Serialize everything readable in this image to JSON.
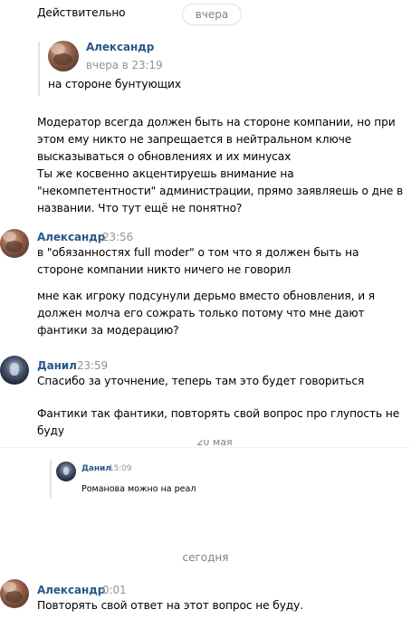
{
  "top_fragment": "Действительно",
  "date_pill": "вчера",
  "reply": {
    "author": "Александр",
    "time": "вчера в 23:19",
    "text": "на стороне бунтующих"
  },
  "message1_lines": [
    "Модератор всегда должен быть на стороне компании, но при",
    "этом ему никто не запрещается в нейтральном ключе",
    "высказываться о обновлениях и их минусах",
    "Ты же косвенно акцентируешь внимание на",
    "\"некомпетентности\" администрации, прямо заявляешь о дне в",
    "названии. Что тут ещё не понятно?"
  ],
  "msg_alex1": {
    "author": "Александр",
    "time": "23:56",
    "lines_a": [
      "в \"обязанностях full moder\" о том что я должен быть на",
      "стороне компании никто ничего не говорил"
    ],
    "lines_b": [
      "мне как игроку подсунули дерьмо вместо обновления, и я",
      "должен молча его сожрать только потому что мне дают",
      "фантики за модерацию?"
    ]
  },
  "msg_danil": {
    "author": "Данил",
    "time": "23:59",
    "line_a": "Спасибо за уточнение, теперь там это будет говориться",
    "lines_b": [
      "Фантики так фантики, повторять свой вопрос про глупость не",
      "буду"
    ]
  },
  "cut_fragment": "20 мая",
  "forward": {
    "author": "Данил",
    "time": "15:09",
    "text": "Романова можно на реал"
  },
  "date_today": "сегодня",
  "msg_alex2": {
    "author": "Александр",
    "time": "0:01",
    "text": "Повторять свой ответ на этот вопрос не буду."
  }
}
